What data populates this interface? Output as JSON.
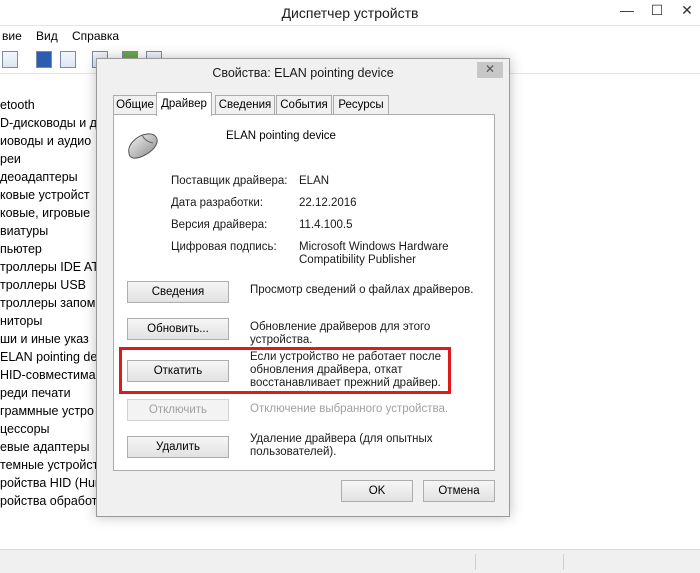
{
  "main_window": {
    "title": "Диспетчер устройств",
    "menu": [
      "вие",
      "Вид",
      "Справка"
    ],
    "tree_items": [
      "etooth",
      "D-дисководы и д",
      "иоводы и аудио",
      "реи",
      "деоадаптеры",
      "ковые устройст",
      "ковые, игровые",
      "виатуры",
      "пьютер",
      "троллеры IDE AT",
      "троллеры USB",
      "троллеры запом",
      "ниторы",
      "ши и иные указ",
      "ELAN pointing dev",
      "HID-совместима",
      "реди печати",
      "граммные устро",
      "цессоры",
      "евые адаптеры",
      "темные устройст",
      "ройства HID (Hum",
      "ройства обработ"
    ]
  },
  "dialog": {
    "title": "Свойства: ELAN pointing device",
    "close_glyph": "✕",
    "tabs": [
      "Общие",
      "Драйвер",
      "Сведения",
      "События",
      "Ресурсы"
    ],
    "active_tab": "Драйвер",
    "device_name": "ELAN pointing device",
    "info": [
      {
        "label": "Поставщик драйвера:",
        "value": "ELAN"
      },
      {
        "label": "Дата разработки:",
        "value": "22.12.2016"
      },
      {
        "label": "Версия драйвера:",
        "value": "11.4.100.5"
      },
      {
        "label": "Цифровая подпись:",
        "value": "Microsoft Windows Hardware\nCompatibility Publisher"
      }
    ],
    "actions": [
      {
        "label": "Сведения",
        "desc": "Просмотр сведений о файлах драйверов.",
        "enabled": true
      },
      {
        "label": "Обновить...",
        "desc": "Обновление драйверов для этого устройства.",
        "enabled": true
      },
      {
        "label": "Откатить",
        "desc": "Если устройство не работает после обновления драйвера, откат восстанавливает прежний драйвер.",
        "enabled": true
      },
      {
        "label": "Отключить",
        "desc": "Отключение выбранного устройства.",
        "enabled": false
      },
      {
        "label": "Удалить",
        "desc": "Удаление драйвера (для опытных пользователей).",
        "enabled": true
      }
    ],
    "ok_label": "OK",
    "cancel_label": "Отмена"
  },
  "colors": {
    "highlight": "#e01a1a",
    "dialog_bg": "#f0f0f0",
    "panel_bg": "#ffffff"
  },
  "icons": {
    "device": "mouse-icon",
    "minimize": "minimize-icon",
    "maximize": "maximize-icon",
    "close": "close-icon"
  }
}
